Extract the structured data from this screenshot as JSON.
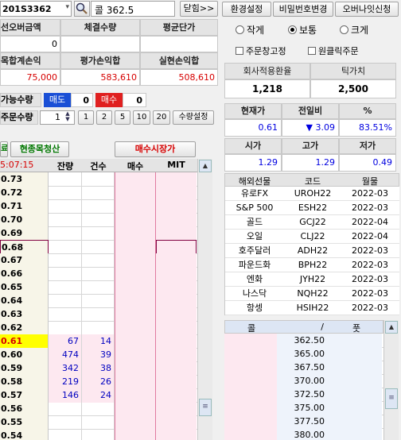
{
  "header": {
    "symbol": "201S3362",
    "search_text": "콜 362.5",
    "close_btn": "닫힘>>",
    "env_btn": "환경설정",
    "pw_btn": "비밀번호변경",
    "overnight_btn": "오버나잇신청"
  },
  "account": {
    "headers": [
      "선오버금액",
      "체결수량",
      "평균단가"
    ],
    "values": [
      "0",
      "",
      ""
    ],
    "headers2": [
      "목합계손익",
      "평가손익합",
      "실현손익합"
    ],
    "values2": [
      "75,000",
      "583,610",
      "508,610"
    ]
  },
  "order": {
    "possible_label": "가능수량",
    "sell_label": "매도",
    "sell_qty": "0",
    "buy_label": "매수",
    "buy_qty": "0",
    "qty_label": "주문수량",
    "qty_value": "1",
    "quick": [
      "1",
      "2",
      "5",
      "10",
      "20"
    ],
    "qty_setting": "수량설정"
  },
  "actions": {
    "close_left": "료",
    "clear_position": "현종목청산",
    "market_buy": "매수시장가"
  },
  "ladder": {
    "time": "5:07:15",
    "headers": [
      "잔량",
      "건수",
      "매수",
      "MIT"
    ],
    "rows": [
      {
        "price": "0.73",
        "bal": "",
        "cnt": ""
      },
      {
        "price": "0.72",
        "bal": "",
        "cnt": ""
      },
      {
        "price": "0.71",
        "bal": "",
        "cnt": ""
      },
      {
        "price": "0.70",
        "bal": "",
        "cnt": ""
      },
      {
        "price": "0.69",
        "bal": "",
        "cnt": ""
      },
      {
        "price": "0.68",
        "bal": "",
        "cnt": ""
      },
      {
        "price": "0.67",
        "bal": "",
        "cnt": ""
      },
      {
        "price": "0.66",
        "bal": "",
        "cnt": ""
      },
      {
        "price": "0.65",
        "bal": "",
        "cnt": ""
      },
      {
        "price": "0.64",
        "bal": "",
        "cnt": ""
      },
      {
        "price": "0.63",
        "bal": "",
        "cnt": ""
      },
      {
        "price": "0.62",
        "bal": "",
        "cnt": ""
      },
      {
        "price": "0.61",
        "bal": "67",
        "cnt": "14"
      },
      {
        "price": "0.60",
        "bal": "474",
        "cnt": "39"
      },
      {
        "price": "0.59",
        "bal": "342",
        "cnt": "38"
      },
      {
        "price": "0.58",
        "bal": "219",
        "cnt": "26"
      },
      {
        "price": "0.57",
        "bal": "146",
        "cnt": "24"
      },
      {
        "price": "0.56",
        "bal": "",
        "cnt": ""
      },
      {
        "price": "0.55",
        "bal": "",
        "cnt": ""
      },
      {
        "price": "0.54",
        "bal": "",
        "cnt": ""
      }
    ]
  },
  "display": {
    "small": "작게",
    "normal": "보통",
    "large": "크게",
    "order_lock": "주문창고정",
    "one_click": "원클릭주문"
  },
  "rates": {
    "exchange_label": "회사적용환율",
    "tick_label": "틱가치",
    "exchange_value": "1,218",
    "tick_value": "2,500"
  },
  "quote": {
    "h1": [
      "현재가",
      "전일비",
      "%"
    ],
    "v1": [
      "0.61",
      "▼ 3.09",
      "83.51%"
    ],
    "h2": [
      "시가",
      "고가",
      "저가"
    ],
    "v2": [
      "1.29",
      "1.29",
      "0.49"
    ]
  },
  "futures": {
    "headers": [
      "해외선물",
      "코드",
      "월물"
    ],
    "rows": [
      [
        "유로FX",
        "UROH22",
        "2022-03"
      ],
      [
        "S&P 500",
        "ESH22",
        "2022-03"
      ],
      [
        "골드",
        "GCJ22",
        "2022-04"
      ],
      [
        "오일",
        "CLJ22",
        "2022-04"
      ],
      [
        "호주달러",
        "ADH22",
        "2022-03"
      ],
      [
        "파운드화",
        "BPH22",
        "2022-03"
      ],
      [
        "엔화",
        "JYH22",
        "2022-03"
      ],
      [
        "나스닥",
        "NQH22",
        "2022-03"
      ],
      [
        "항셍",
        "HSIH22",
        "2022-03"
      ]
    ]
  },
  "options": {
    "headers": [
      "콜",
      "/",
      "풋"
    ],
    "prices": [
      "362.50",
      "365.00",
      "367.50",
      "370.00",
      "372.50",
      "375.00",
      "377.50",
      "380.00"
    ]
  },
  "colors": {
    "buy_red": "#d60000",
    "sell_blue": "#0000e0",
    "highlight_yellow": "#ffff00",
    "buy_pink": "#fde8f0"
  }
}
